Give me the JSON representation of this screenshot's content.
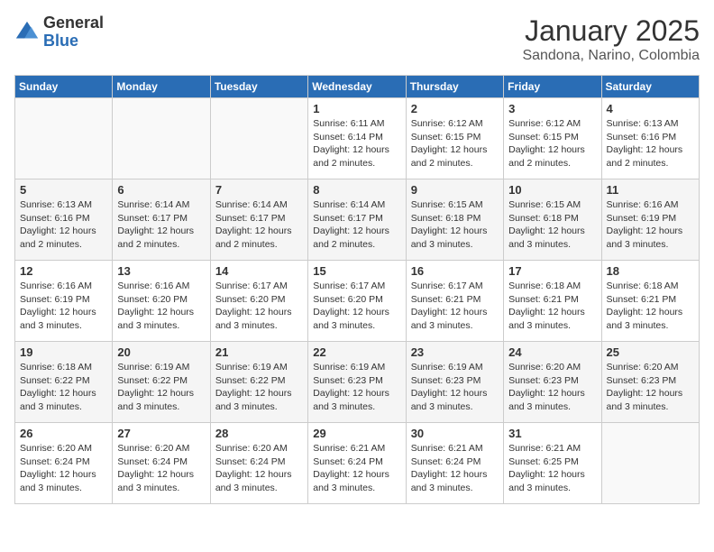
{
  "logo": {
    "general": "General",
    "blue": "Blue"
  },
  "title": "January 2025",
  "subtitle": "Sandona, Narino, Colombia",
  "days_of_week": [
    "Sunday",
    "Monday",
    "Tuesday",
    "Wednesday",
    "Thursday",
    "Friday",
    "Saturday"
  ],
  "weeks": [
    [
      {
        "day": "",
        "sunrise": "",
        "sunset": "",
        "daylight": ""
      },
      {
        "day": "",
        "sunrise": "",
        "sunset": "",
        "daylight": ""
      },
      {
        "day": "",
        "sunrise": "",
        "sunset": "",
        "daylight": ""
      },
      {
        "day": "1",
        "sunrise": "Sunrise: 6:11 AM",
        "sunset": "Sunset: 6:14 PM",
        "daylight": "Daylight: 12 hours and 2 minutes."
      },
      {
        "day": "2",
        "sunrise": "Sunrise: 6:12 AM",
        "sunset": "Sunset: 6:15 PM",
        "daylight": "Daylight: 12 hours and 2 minutes."
      },
      {
        "day": "3",
        "sunrise": "Sunrise: 6:12 AM",
        "sunset": "Sunset: 6:15 PM",
        "daylight": "Daylight: 12 hours and 2 minutes."
      },
      {
        "day": "4",
        "sunrise": "Sunrise: 6:13 AM",
        "sunset": "Sunset: 6:16 PM",
        "daylight": "Daylight: 12 hours and 2 minutes."
      }
    ],
    [
      {
        "day": "5",
        "sunrise": "Sunrise: 6:13 AM",
        "sunset": "Sunset: 6:16 PM",
        "daylight": "Daylight: 12 hours and 2 minutes."
      },
      {
        "day": "6",
        "sunrise": "Sunrise: 6:14 AM",
        "sunset": "Sunset: 6:17 PM",
        "daylight": "Daylight: 12 hours and 2 minutes."
      },
      {
        "day": "7",
        "sunrise": "Sunrise: 6:14 AM",
        "sunset": "Sunset: 6:17 PM",
        "daylight": "Daylight: 12 hours and 2 minutes."
      },
      {
        "day": "8",
        "sunrise": "Sunrise: 6:14 AM",
        "sunset": "Sunset: 6:17 PM",
        "daylight": "Daylight: 12 hours and 2 minutes."
      },
      {
        "day": "9",
        "sunrise": "Sunrise: 6:15 AM",
        "sunset": "Sunset: 6:18 PM",
        "daylight": "Daylight: 12 hours and 3 minutes."
      },
      {
        "day": "10",
        "sunrise": "Sunrise: 6:15 AM",
        "sunset": "Sunset: 6:18 PM",
        "daylight": "Daylight: 12 hours and 3 minutes."
      },
      {
        "day": "11",
        "sunrise": "Sunrise: 6:16 AM",
        "sunset": "Sunset: 6:19 PM",
        "daylight": "Daylight: 12 hours and 3 minutes."
      }
    ],
    [
      {
        "day": "12",
        "sunrise": "Sunrise: 6:16 AM",
        "sunset": "Sunset: 6:19 PM",
        "daylight": "Daylight: 12 hours and 3 minutes."
      },
      {
        "day": "13",
        "sunrise": "Sunrise: 6:16 AM",
        "sunset": "Sunset: 6:20 PM",
        "daylight": "Daylight: 12 hours and 3 minutes."
      },
      {
        "day": "14",
        "sunrise": "Sunrise: 6:17 AM",
        "sunset": "Sunset: 6:20 PM",
        "daylight": "Daylight: 12 hours and 3 minutes."
      },
      {
        "day": "15",
        "sunrise": "Sunrise: 6:17 AM",
        "sunset": "Sunset: 6:20 PM",
        "daylight": "Daylight: 12 hours and 3 minutes."
      },
      {
        "day": "16",
        "sunrise": "Sunrise: 6:17 AM",
        "sunset": "Sunset: 6:21 PM",
        "daylight": "Daylight: 12 hours and 3 minutes."
      },
      {
        "day": "17",
        "sunrise": "Sunrise: 6:18 AM",
        "sunset": "Sunset: 6:21 PM",
        "daylight": "Daylight: 12 hours and 3 minutes."
      },
      {
        "day": "18",
        "sunrise": "Sunrise: 6:18 AM",
        "sunset": "Sunset: 6:21 PM",
        "daylight": "Daylight: 12 hours and 3 minutes."
      }
    ],
    [
      {
        "day": "19",
        "sunrise": "Sunrise: 6:18 AM",
        "sunset": "Sunset: 6:22 PM",
        "daylight": "Daylight: 12 hours and 3 minutes."
      },
      {
        "day": "20",
        "sunrise": "Sunrise: 6:19 AM",
        "sunset": "Sunset: 6:22 PM",
        "daylight": "Daylight: 12 hours and 3 minutes."
      },
      {
        "day": "21",
        "sunrise": "Sunrise: 6:19 AM",
        "sunset": "Sunset: 6:22 PM",
        "daylight": "Daylight: 12 hours and 3 minutes."
      },
      {
        "day": "22",
        "sunrise": "Sunrise: 6:19 AM",
        "sunset": "Sunset: 6:23 PM",
        "daylight": "Daylight: 12 hours and 3 minutes."
      },
      {
        "day": "23",
        "sunrise": "Sunrise: 6:19 AM",
        "sunset": "Sunset: 6:23 PM",
        "daylight": "Daylight: 12 hours and 3 minutes."
      },
      {
        "day": "24",
        "sunrise": "Sunrise: 6:20 AM",
        "sunset": "Sunset: 6:23 PM",
        "daylight": "Daylight: 12 hours and 3 minutes."
      },
      {
        "day": "25",
        "sunrise": "Sunrise: 6:20 AM",
        "sunset": "Sunset: 6:23 PM",
        "daylight": "Daylight: 12 hours and 3 minutes."
      }
    ],
    [
      {
        "day": "26",
        "sunrise": "Sunrise: 6:20 AM",
        "sunset": "Sunset: 6:24 PM",
        "daylight": "Daylight: 12 hours and 3 minutes."
      },
      {
        "day": "27",
        "sunrise": "Sunrise: 6:20 AM",
        "sunset": "Sunset: 6:24 PM",
        "daylight": "Daylight: 12 hours and 3 minutes."
      },
      {
        "day": "28",
        "sunrise": "Sunrise: 6:20 AM",
        "sunset": "Sunset: 6:24 PM",
        "daylight": "Daylight: 12 hours and 3 minutes."
      },
      {
        "day": "29",
        "sunrise": "Sunrise: 6:21 AM",
        "sunset": "Sunset: 6:24 PM",
        "daylight": "Daylight: 12 hours and 3 minutes."
      },
      {
        "day": "30",
        "sunrise": "Sunrise: 6:21 AM",
        "sunset": "Sunset: 6:24 PM",
        "daylight": "Daylight: 12 hours and 3 minutes."
      },
      {
        "day": "31",
        "sunrise": "Sunrise: 6:21 AM",
        "sunset": "Sunset: 6:25 PM",
        "daylight": "Daylight: 12 hours and 3 minutes."
      },
      {
        "day": "",
        "sunrise": "",
        "sunset": "",
        "daylight": ""
      }
    ]
  ]
}
